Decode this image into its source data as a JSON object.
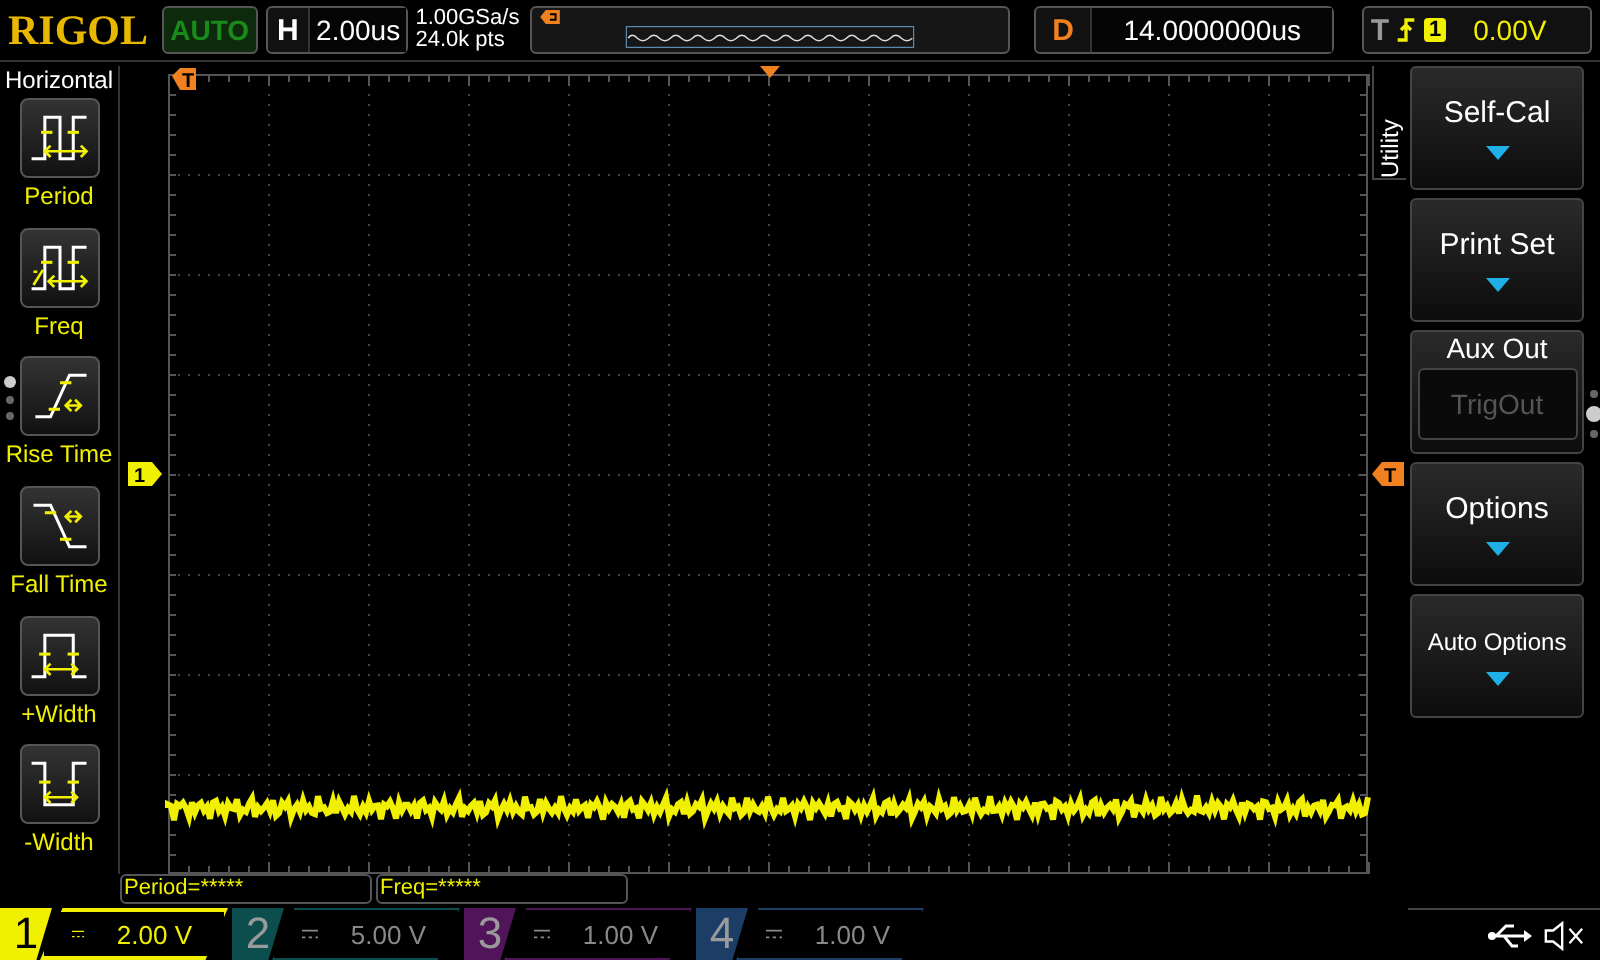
{
  "top_bar": {
    "logo": "RIGOL",
    "run_mode": "AUTO",
    "timebase": {
      "label": "H",
      "value": "2.00us"
    },
    "sample_rate": "1.00GSa/s",
    "memory_depth": "24.0k pts",
    "delay": {
      "label": "D",
      "value": "14.0000000us"
    },
    "trigger": {
      "label": "T",
      "source": "1",
      "level": "0.00V"
    }
  },
  "sidebar": {
    "title": "Horizontal",
    "items": [
      {
        "kind": "period",
        "label": "Period"
      },
      {
        "kind": "freq",
        "label": "Freq"
      },
      {
        "kind": "rise",
        "label": "Rise Time"
      },
      {
        "kind": "fall",
        "label": "Fall Time"
      },
      {
        "kind": "pwidth",
        "label": "+Width"
      },
      {
        "kind": "nwidth",
        "label": "-Width"
      }
    ]
  },
  "plot": {
    "trigger_position_marker": "T",
    "channel_marker": "1",
    "trigger_level_marker": "T"
  },
  "measurements": [
    "Period=*****",
    "Freq=*****"
  ],
  "menu": {
    "title": "Utility",
    "items": [
      {
        "kind": "submenu",
        "label": "Self-Cal"
      },
      {
        "kind": "submenu",
        "label": "Print Set"
      },
      {
        "kind": "select",
        "label": "Aux Out",
        "value": "TrigOut",
        "disabled": true
      },
      {
        "kind": "submenu",
        "label": "Options"
      },
      {
        "kind": "submenu",
        "label": "Auto Options"
      }
    ]
  },
  "channels": [
    {
      "number": "1",
      "scale": "2.00 V",
      "color": "#f0f000",
      "selected": true
    },
    {
      "number": "2",
      "scale": "5.00 V",
      "color": "#0c4e4e",
      "selected": false
    },
    {
      "number": "3",
      "scale": "1.00 V",
      "color": "#501458",
      "selected": false
    },
    {
      "number": "4",
      "scale": "1.00 V",
      "color": "#1c3e66",
      "selected": false
    }
  ]
}
